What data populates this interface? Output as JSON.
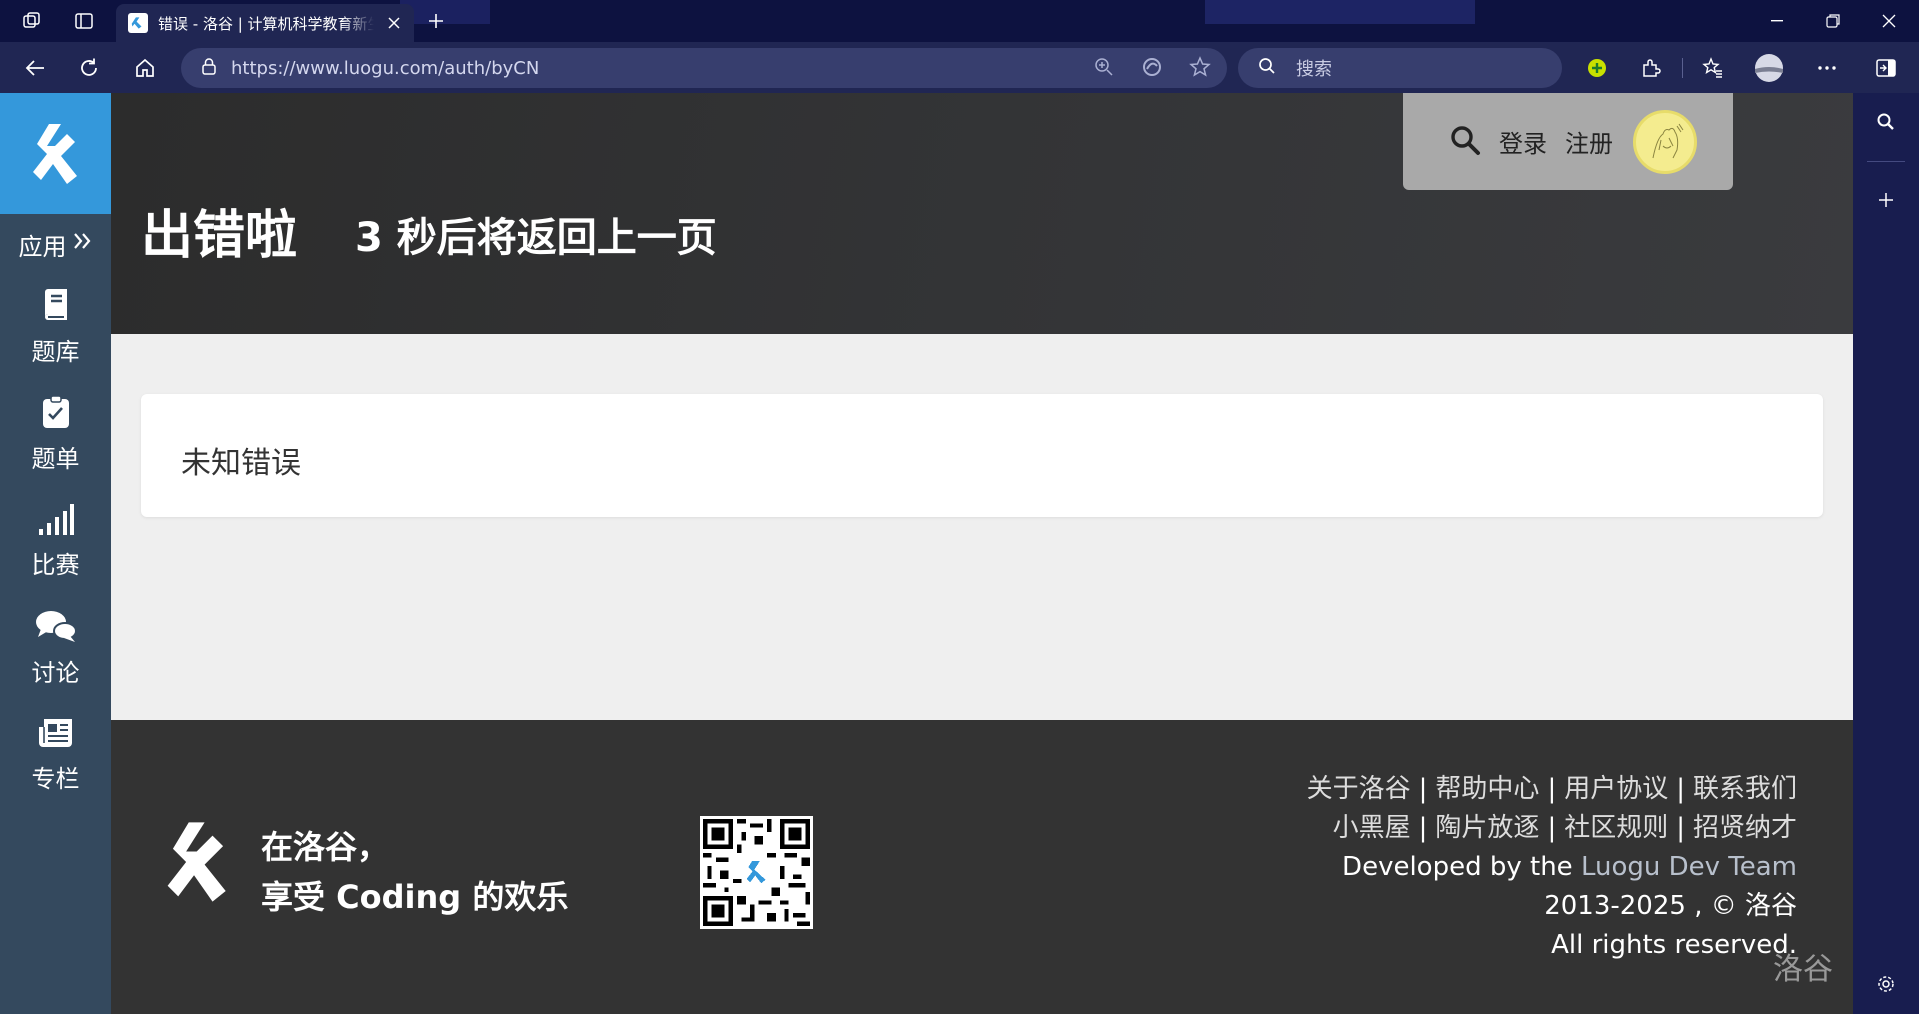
{
  "browser": {
    "tab_title": "错误 - 洛谷 | 计算机科学教育新生态",
    "url": "https://www.luogu.com/auth/byCN",
    "search_placeholder": "搜索"
  },
  "sidebar": {
    "apps_label": "应用",
    "items": [
      {
        "label": "题库",
        "icon": "book-icon"
      },
      {
        "label": "题单",
        "icon": "clipboard-icon"
      },
      {
        "label": "比赛",
        "icon": "signal-bars-icon"
      },
      {
        "label": "讨论",
        "icon": "comments-icon"
      },
      {
        "label": "专栏",
        "icon": "newspaper-icon"
      }
    ]
  },
  "header": {
    "title": "出错啦",
    "subtitle": "3 秒后将返回上一页",
    "login": "登录",
    "register": "注册"
  },
  "error": {
    "message": "未知错误"
  },
  "footer": {
    "slogan_line1": "在洛谷，",
    "slogan_line2": "享受 Coding 的欢乐",
    "links_row1": [
      "关于洛谷",
      "帮助中心",
      "用户协议",
      "联系我们"
    ],
    "links_row2": [
      "小黑屋",
      "陶片放逐",
      "社区规则",
      "招贤纳才"
    ],
    "dev_prefix": "Developed by the",
    "dev_team": "Luogu Dev Team",
    "copyright": "2013-2025 , © 洛谷",
    "rights": "All rights reserved."
  },
  "watermark": "洛谷",
  "colors": {
    "brand_blue": "#3498db",
    "sidebar": "#34495e",
    "footer": "#333333"
  }
}
